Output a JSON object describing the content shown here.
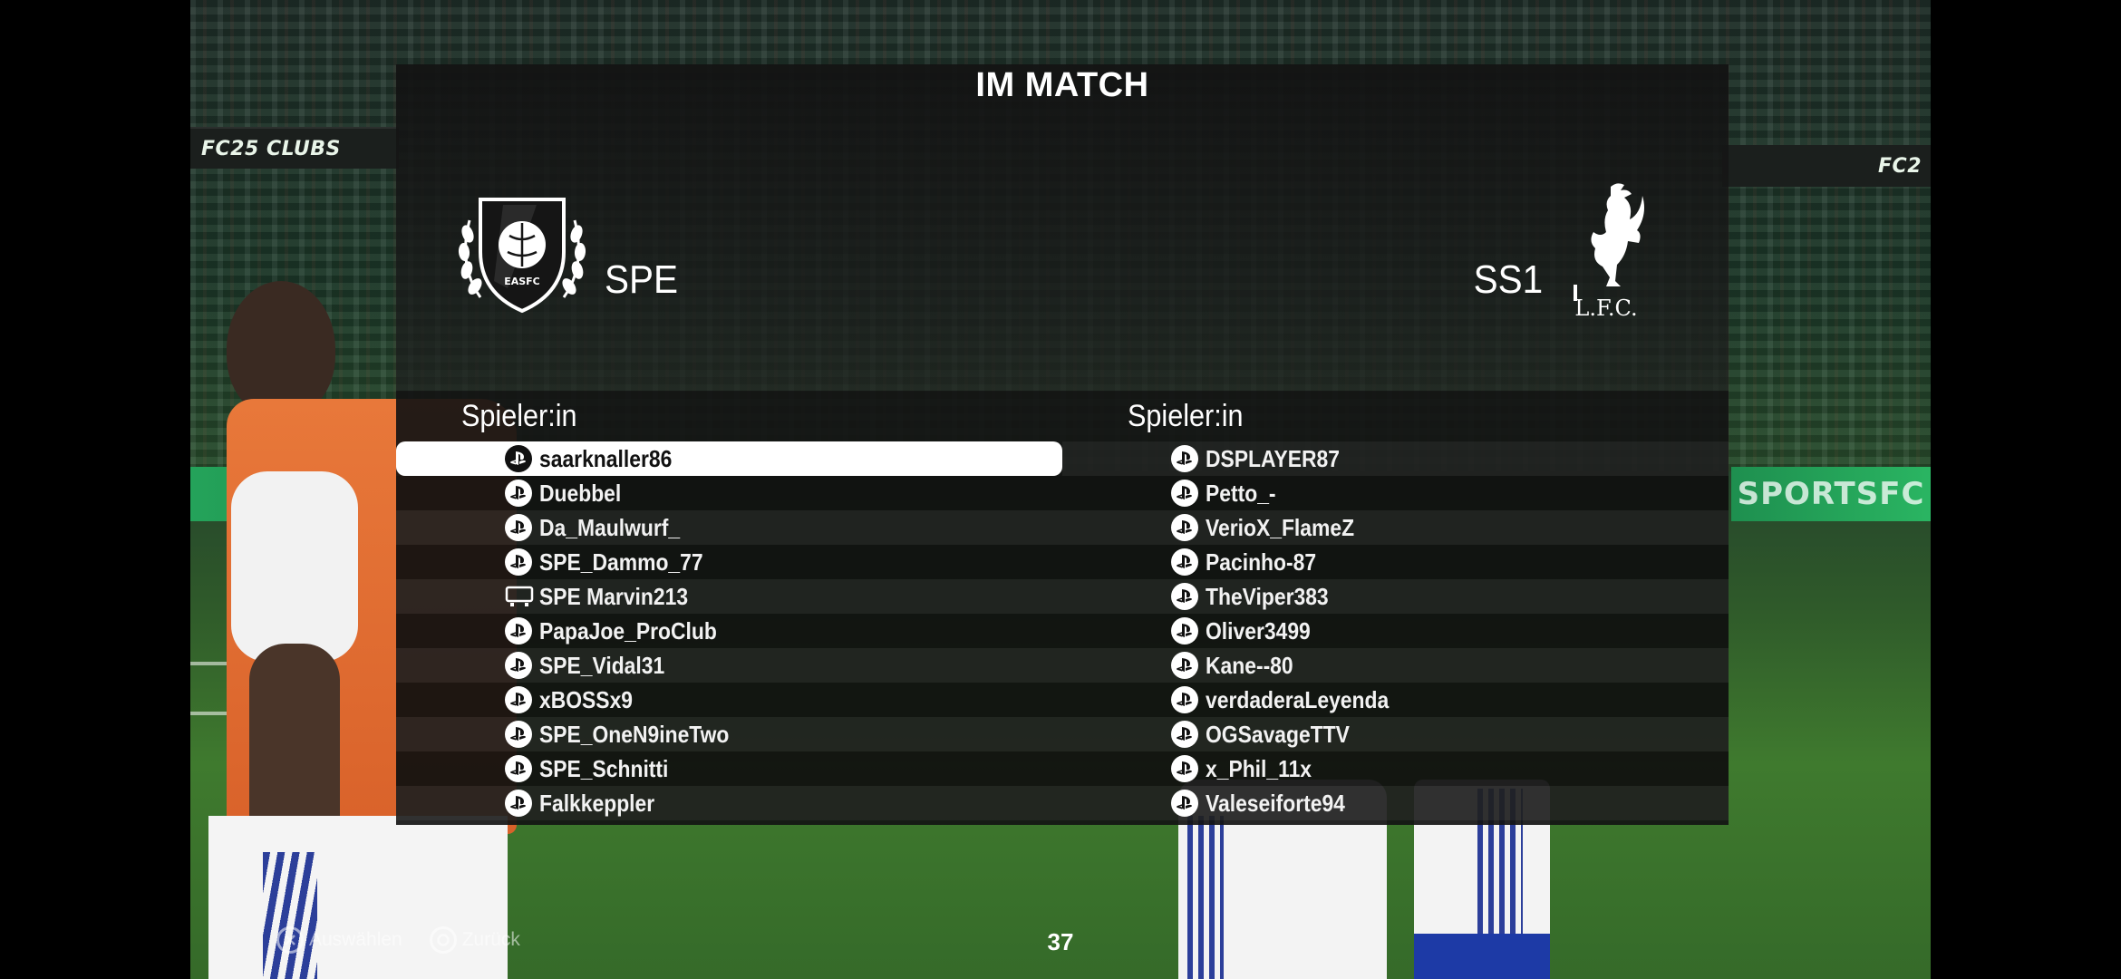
{
  "screen": {
    "title": "IM MATCH",
    "page_number": "37"
  },
  "ads": {
    "left_board": "FC25 CLUBS",
    "right_board": "FC2",
    "green_board": "SPORTSFC"
  },
  "home": {
    "team_name": "SPE",
    "crest_text": "EASFC",
    "column_header": "Spieler:in",
    "players": [
      {
        "name": "saarknaller86",
        "platform": "playstation",
        "selected": true
      },
      {
        "name": "Duebbel",
        "platform": "playstation"
      },
      {
        "name": "Da_Maulwurf_",
        "platform": "playstation"
      },
      {
        "name": "SPE_Dammo_77",
        "platform": "playstation"
      },
      {
        "name": "SPE Marvin213",
        "platform": "pc"
      },
      {
        "name": "PapaJoe_ProClub",
        "platform": "playstation"
      },
      {
        "name": "SPE_Vidal31",
        "platform": "playstation"
      },
      {
        "name": "xBOSSx9",
        "platform": "playstation"
      },
      {
        "name": "SPE_OneN9ineTwo",
        "platform": "playstation"
      },
      {
        "name": "SPE_Schnitti",
        "platform": "playstation"
      },
      {
        "name": "Falkkeppler",
        "platform": "playstation"
      }
    ]
  },
  "away": {
    "team_name": "SS1",
    "crest_text": "L.F.C.",
    "column_header": "Spieler:in",
    "players": [
      {
        "name": "DSPLAYER87",
        "platform": "playstation"
      },
      {
        "name": "Petto_-",
        "platform": "playstation"
      },
      {
        "name": "VerioX_FlameZ",
        "platform": "playstation"
      },
      {
        "name": "Pacinho-87",
        "platform": "playstation"
      },
      {
        "name": "TheViper383",
        "platform": "playstation"
      },
      {
        "name": "Oliver3499",
        "platform": "playstation"
      },
      {
        "name": "Kane--80",
        "platform": "playstation"
      },
      {
        "name": "verdaderaLeyenda",
        "platform": "playstation"
      },
      {
        "name": "OGSavageTTV",
        "platform": "playstation"
      },
      {
        "name": "x_Phil_11x",
        "platform": "playstation"
      },
      {
        "name": "Valeseiforte94",
        "platform": "playstation"
      }
    ]
  },
  "footer": {
    "select_label": "Auswählen",
    "back_label": "Zurück"
  },
  "colors": {
    "selected_row": "#ffffff",
    "panel": "#141414",
    "accent_green": "#3ddc6a"
  },
  "icons": {
    "playstation": "playstation-icon",
    "pc": "pc-icon",
    "select": "cross-button-icon",
    "back": "circle-button-icon"
  }
}
